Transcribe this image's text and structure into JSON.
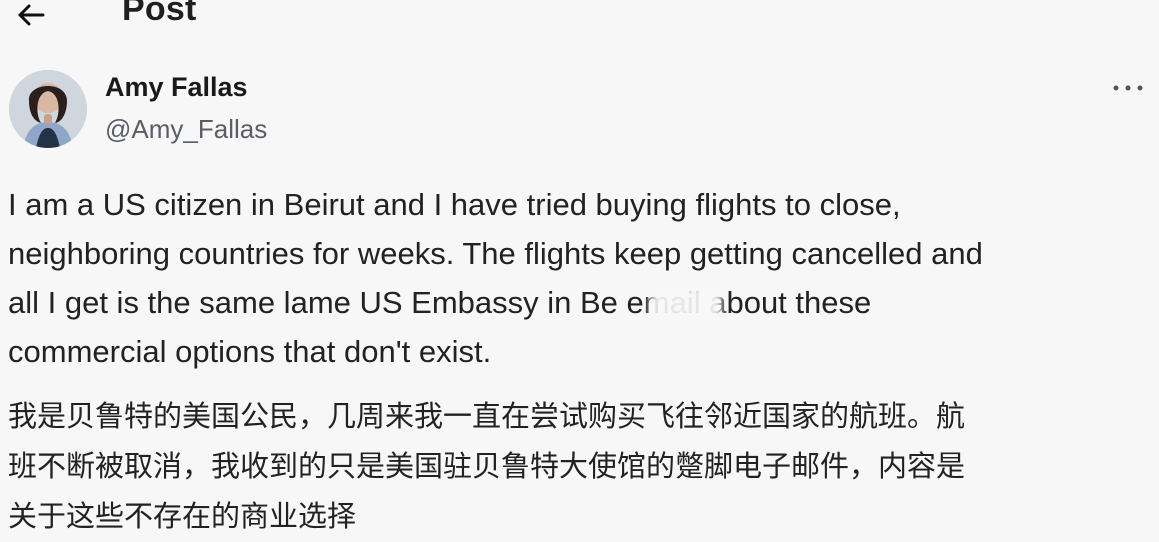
{
  "header": {
    "title": "Post",
    "back_icon": "arrow-left-icon"
  },
  "author": {
    "name": "Amy Fallas",
    "handle": "@Amy_Fallas",
    "avatar_icon": "avatar-photo"
  },
  "post": {
    "text_en": "I am a US citizen in Beirut and I have tried buying flights to close,\nneighboring countries for weeks. The flights keep getting cancelled and\nall I get is the same lame US Embassy in Be      email about these\ncommercial options that don't exist.",
    "text_zh": "我是贝鲁特的美国公民，几周来我一直在尝试购买飞往邻近国家的航班。航\n班不断被取消，我收到的只是美国驻贝鲁特大使馆的蹩脚电子邮件，内容是\n关于这些不存在的商业选择"
  },
  "actions": {
    "more_icon": "more-horizontal-icon"
  }
}
